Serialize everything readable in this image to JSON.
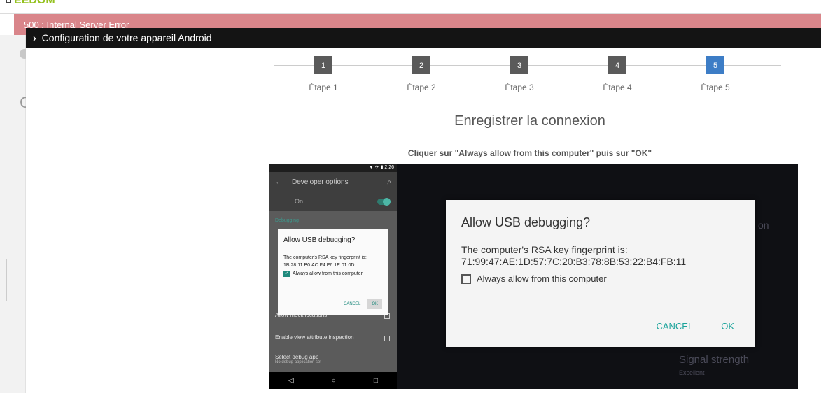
{
  "topbar": {
    "logo": "EEDOM"
  },
  "error_banner": "500 : Internal Server Error",
  "modal": {
    "title": "Configuration de votre appareil Android",
    "steps": [
      {
        "num": "1",
        "label": "Étape 1",
        "active": false
      },
      {
        "num": "2",
        "label": "Étape 2",
        "active": false
      },
      {
        "num": "3",
        "label": "Étape 3",
        "active": false
      },
      {
        "num": "4",
        "label": "Étape 4",
        "active": false
      },
      {
        "num": "5",
        "label": "Étape 5",
        "active": true
      }
    ],
    "heading": "Enregistrer la connexion",
    "instruction": "Cliquer sur \"Always allow from this computer\" puis sur \"OK\""
  },
  "phone": {
    "time": "▼ ✈ ▮ 2:26",
    "appbar_title": "Developer options",
    "on_label": "On",
    "section": "Debugging",
    "items": [
      {
        "title": "Allow mock locations",
        "sub": ""
      },
      {
        "title": "Enable view attribute inspection",
        "sub": ""
      },
      {
        "title": "Select debug app",
        "sub": "No debug application set"
      }
    ],
    "dialog": {
      "title": "Allow USB debugging?",
      "body_line1": "The computer's RSA key fingerprint is:",
      "body_line2": "1B:28:11:B0:AC:F4:E6:1E:01:0D:",
      "checkbox": "Always allow from this computer",
      "cancel": "CANCEL",
      "ok": "OK"
    }
  },
  "tv": {
    "bg_texts": [
      "on",
      "Signal strength",
      "Excellent"
    ],
    "dialog": {
      "title": "Allow USB debugging?",
      "body_line1": "The computer's RSA key fingerprint is:",
      "body_line2": "71:99:47:AE:1D:57:7C:20:B3:78:8B:53:22:B4:FB:11",
      "checkbox": "Always allow from this computer",
      "cancel": "CANCEL",
      "ok": "OK"
    }
  }
}
